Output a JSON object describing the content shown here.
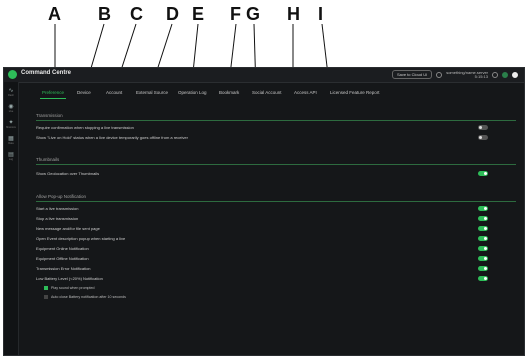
{
  "callouts": [
    "A",
    "B",
    "C",
    "D",
    "E",
    "F",
    "G",
    "H",
    "I"
  ],
  "app": {
    "title": "Command Centre",
    "toolbar_button": "Save to Cloud UI",
    "status_line1": "something/name.server",
    "status_line2": "5:15:13"
  },
  "sidebar": {
    "items": [
      {
        "icon": "activity-icon",
        "glyph": "∿",
        "label": "Dash"
      },
      {
        "icon": "record-icon",
        "glyph": "◉",
        "label": "Live"
      },
      {
        "icon": "compass-icon",
        "glyph": "✦",
        "label": "Missions"
      },
      {
        "icon": "grid-icon",
        "glyph": "▦",
        "label": "Data"
      },
      {
        "icon": "document-icon",
        "glyph": "▤",
        "label": "Log"
      }
    ]
  },
  "tabs": [
    {
      "label": "Preference",
      "active": true
    },
    {
      "label": "Device"
    },
    {
      "label": "Account"
    },
    {
      "label": "External Source"
    },
    {
      "label": "Operation Log"
    },
    {
      "label": "Bookmark"
    },
    {
      "label": "Social Account"
    },
    {
      "label": "Access API"
    },
    {
      "label": "Licensed Feature Report"
    }
  ],
  "sections": {
    "transmission": {
      "title": "Transmission",
      "rows": [
        {
          "label": "Require confirmation when stopping a live transmission",
          "on": false
        },
        {
          "label": "Show \"Live on Hold\" status when a live device temporarily goes offline from a receiver",
          "on": false
        }
      ]
    },
    "thumbnails": {
      "title": "Thumbnails",
      "rows": [
        {
          "label": "Show Geolocation over Thumbnails",
          "on": true
        }
      ]
    },
    "popup": {
      "title": "Allow Pop-up Notification",
      "rows": [
        {
          "label": "Start a live transmission",
          "on": true
        },
        {
          "label": "Stop a live transmission",
          "on": true
        },
        {
          "label": "New message and/for file sent page",
          "on": true
        },
        {
          "label": "Open Event description popup when starting a live",
          "on": true
        },
        {
          "label": "Equipment Online Notification",
          "on": true
        },
        {
          "label": "Equipment Offline Notification",
          "on": true
        },
        {
          "label": "Transmission Error Notification",
          "on": true
        },
        {
          "label": "Low Battery Level (<20%) Notification",
          "on": true
        }
      ],
      "sub_options": [
        {
          "label": "Play sound when prompted",
          "checked": true
        },
        {
          "label": "Auto close Battery notification after 10 seconds",
          "checked": false
        }
      ]
    }
  }
}
